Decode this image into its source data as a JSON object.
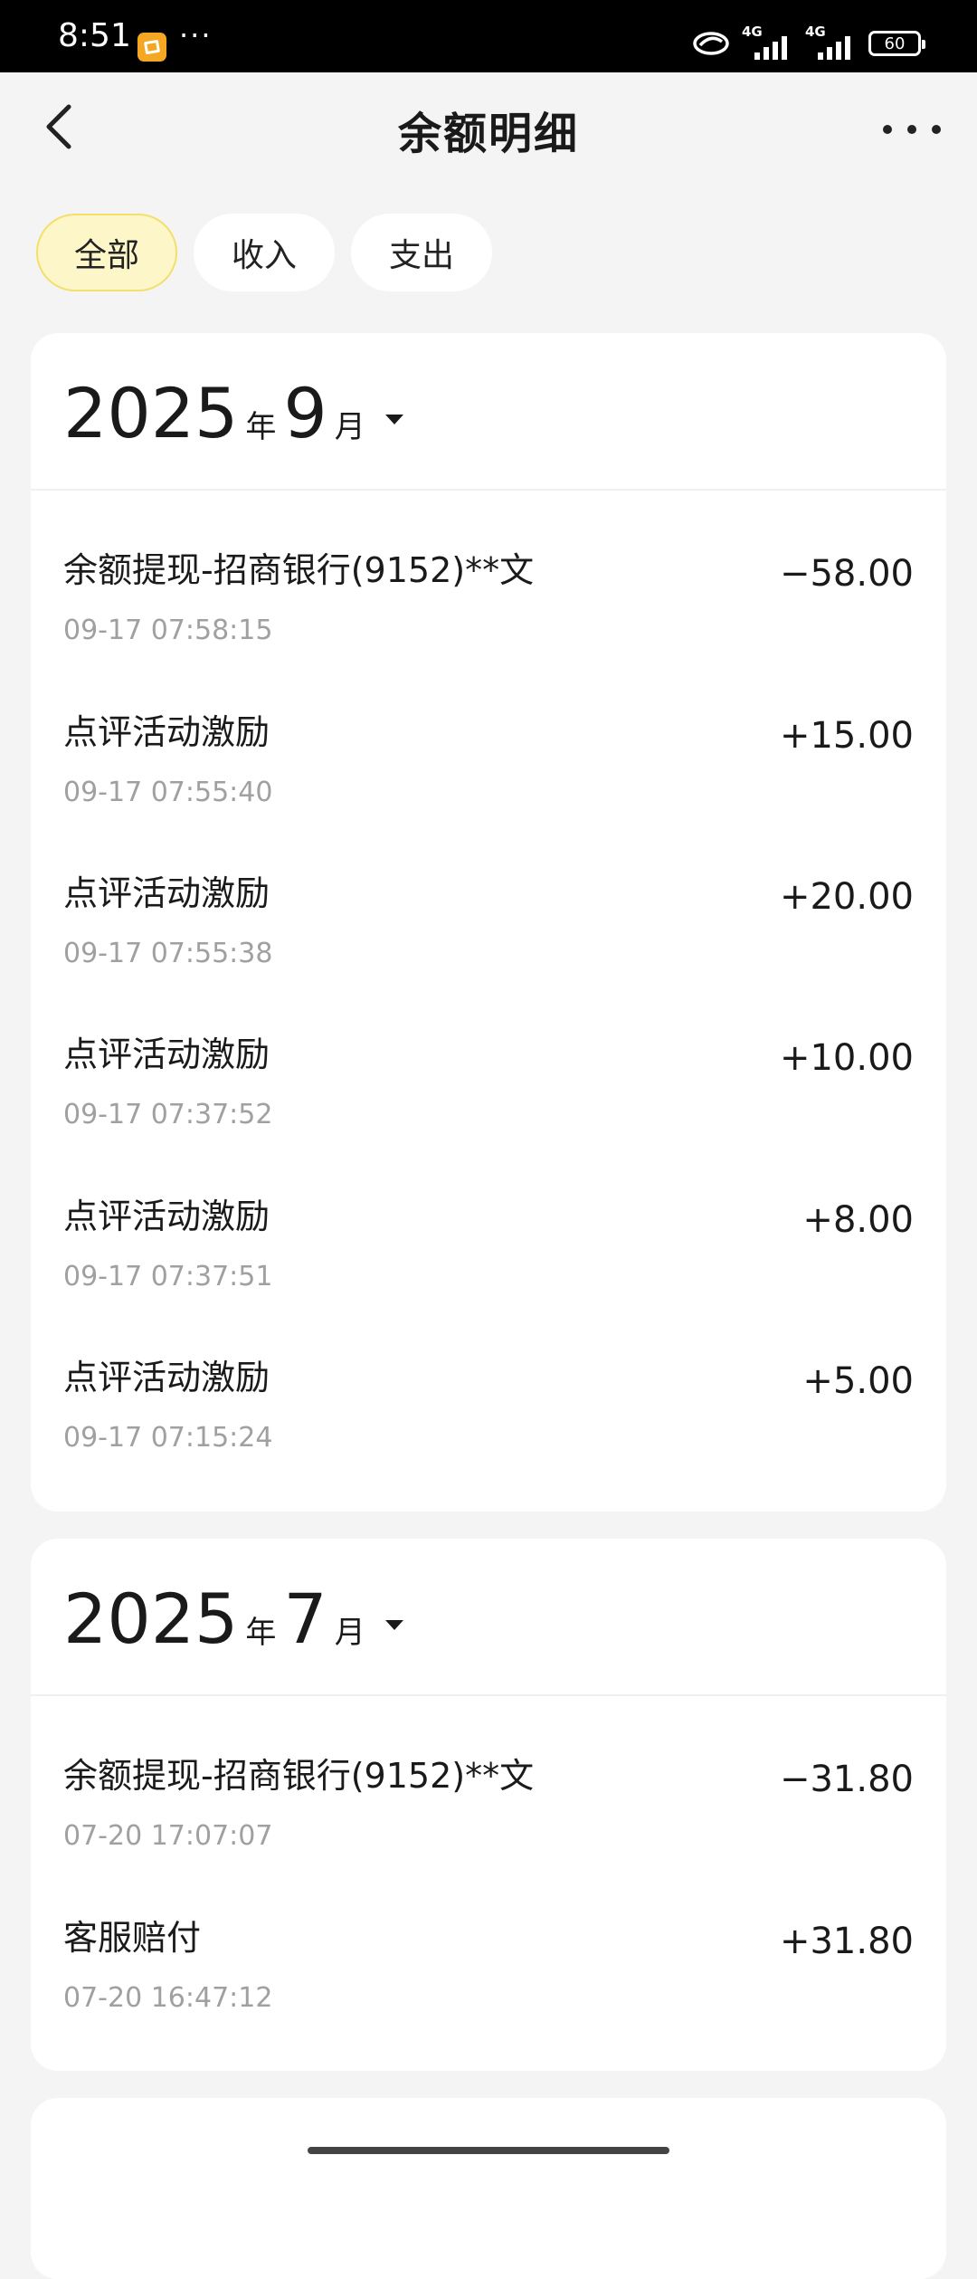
{
  "status_bar": {
    "time": "8:51",
    "more": "···",
    "net1": "4G",
    "net2": "4G",
    "battery": "60"
  },
  "header": {
    "title": "余额明细"
  },
  "tabs": [
    {
      "label": "全部",
      "active": true
    },
    {
      "label": "收入",
      "active": false
    },
    {
      "label": "支出",
      "active": false
    }
  ],
  "months": [
    {
      "year": "2025",
      "year_unit": "年",
      "month": "9",
      "month_unit": "月",
      "items": [
        {
          "desc": "余额提现-招商银行(9152)**文",
          "time": "09-17 07:58:15",
          "amount": "−58.00"
        },
        {
          "desc": "点评活动激励",
          "time": "09-17 07:55:40",
          "amount": "+15.00"
        },
        {
          "desc": "点评活动激励",
          "time": "09-17 07:55:38",
          "amount": "+20.00"
        },
        {
          "desc": "点评活动激励",
          "time": "09-17 07:37:52",
          "amount": "+10.00"
        },
        {
          "desc": "点评活动激励",
          "time": "09-17 07:37:51",
          "amount": "+8.00"
        },
        {
          "desc": "点评活动激励",
          "time": "09-17 07:15:24",
          "amount": "+5.00"
        }
      ]
    },
    {
      "year": "2025",
      "year_unit": "年",
      "month": "7",
      "month_unit": "月",
      "items": [
        {
          "desc": "余额提现-招商银行(9152)**文",
          "time": "07-20 17:07:07",
          "amount": "−31.80"
        },
        {
          "desc": "客服赔付",
          "time": "07-20 16:47:12",
          "amount": "+31.80"
        }
      ]
    }
  ]
}
